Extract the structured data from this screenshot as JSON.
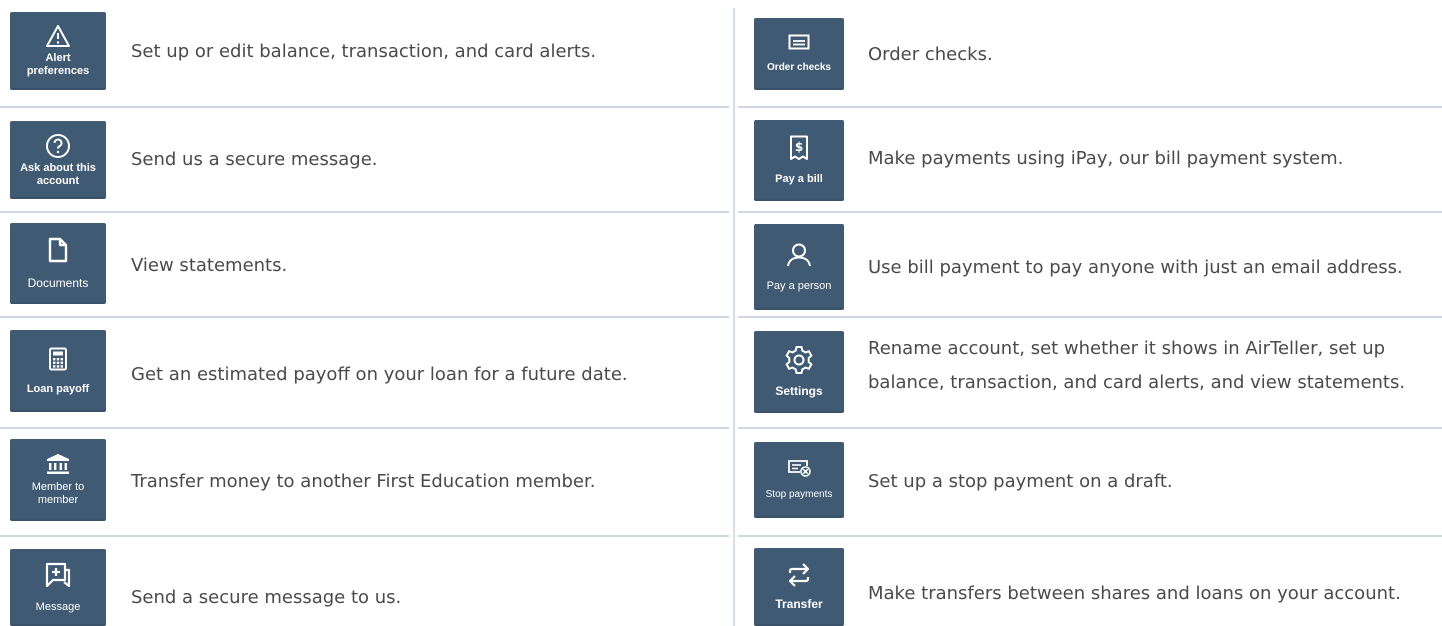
{
  "left_column": [
    {
      "key": "alert-preferences",
      "label": "Alert\npreferences",
      "icon": "alert-triangle-icon",
      "description": "Set up or edit balance, transaction, and card alerts."
    },
    {
      "key": "ask-about-account",
      "label": "Ask about this\naccount",
      "icon": "question-circle-icon",
      "description": "Send us a secure message."
    },
    {
      "key": "documents",
      "label": "Documents",
      "icon": "document-icon",
      "description": "View statements."
    },
    {
      "key": "loan-payoff",
      "label": "Loan payoff",
      "icon": "calculator-icon",
      "description": "Get an estimated payoff on your loan for a future date."
    },
    {
      "key": "member-to-member",
      "label": "Member to\nmember",
      "icon": "bank-icon",
      "description": "Transfer money to another First Education member."
    },
    {
      "key": "message",
      "label": "Message",
      "icon": "message-add-icon",
      "description": "Send a secure message to us."
    }
  ],
  "right_column": [
    {
      "key": "order-checks",
      "label": "Order checks",
      "icon": "check-card-icon",
      "description": "Order checks."
    },
    {
      "key": "pay-a-bill",
      "label": "Pay a bill",
      "icon": "receipt-dollar-icon",
      "description": "Make payments using iPay, our bill payment system."
    },
    {
      "key": "pay-a-person",
      "label": "Pay a person",
      "icon": "person-icon",
      "description": "Use bill payment to pay anyone with just an email address."
    },
    {
      "key": "settings",
      "label": "Settings",
      "icon": "gear-icon",
      "description": "Rename account, set whether it shows in AirTeller, set up balance, transaction, and card alerts, and view statements."
    },
    {
      "key": "stop-payments",
      "label": "Stop payments",
      "icon": "stop-payment-icon",
      "description": "Set up a stop payment on a draft."
    },
    {
      "key": "transfer",
      "label": "Transfer",
      "icon": "transfer-arrows-icon",
      "description": "Make transfers between shares and loans on your account."
    }
  ],
  "colors": {
    "tile_bg": "#3f5a72",
    "text": "#4a4a4a",
    "divider": "#cfd7e0"
  }
}
